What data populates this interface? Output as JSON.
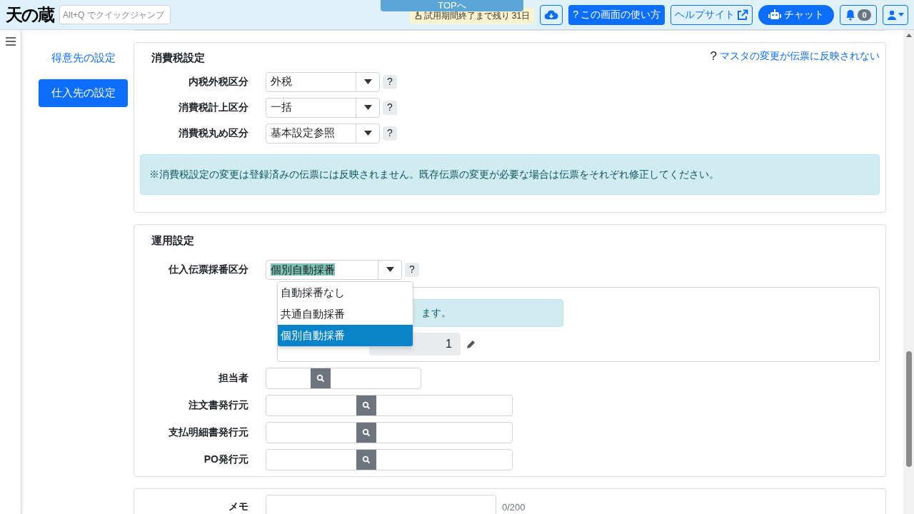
{
  "header": {
    "logo": "天の蔵",
    "jump_placeholder": "Alt+Q でクイックジャンプ",
    "top_button": "TOPへ",
    "trial_notice": "試用期間終了まで残り 31日",
    "help_button": {
      "mark": "?",
      "label": "この画面の使い方"
    },
    "help_site": "ヘルプサイト",
    "chat": "チャット",
    "notification_count": "0"
  },
  "sidebar": {
    "items": [
      {
        "label": "得意先の設定",
        "selected": false
      },
      {
        "label": "仕入先の設定",
        "selected": true
      }
    ]
  },
  "tax_section": {
    "title": "消費税設定",
    "help_link": {
      "mark": "?",
      "label": "マスタの変更が伝票に反映されない"
    },
    "fields": [
      {
        "label": "内税外税区分",
        "value": "外税",
        "help": "?"
      },
      {
        "label": "消費税計上区分",
        "value": "一括",
        "help": "?"
      },
      {
        "label": "消費税丸め区分",
        "value": "基本設定参照",
        "help": "?"
      }
    ],
    "notice": "※消費税設定の変更は登録済みの伝票には反映されません。既存伝票の変更が必要な場合は伝票をそれぞれ修正してください。"
  },
  "operation_section": {
    "title": "運用設定",
    "numbering": {
      "label": "仕入伝票採番区分",
      "value": "個別自動採番",
      "help": "?",
      "expanded": true,
      "options": [
        {
          "label": "自動採番なし",
          "selected": false
        },
        {
          "label": "共通自動採番",
          "selected": false
        },
        {
          "label": "個別自動採番",
          "selected": true
        }
      ]
    },
    "info_text": "ます。",
    "number_value": "1",
    "lookups": [
      {
        "label": "担当者",
        "kind": "short"
      },
      {
        "label": "注文書発行元",
        "kind": "wide"
      },
      {
        "label": "支払明細書発行元",
        "kind": "wide"
      },
      {
        "label": "PO発行元",
        "kind": "wide"
      }
    ]
  },
  "memo": {
    "label": "メモ",
    "counter": "0/200"
  }
}
